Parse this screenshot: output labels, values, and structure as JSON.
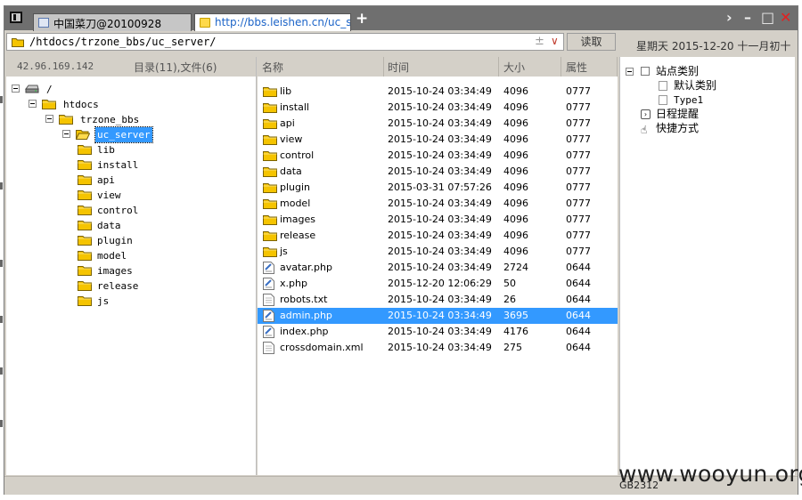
{
  "window": {
    "tabs": [
      {
        "label": "中国菜刀@20100928",
        "active": false
      },
      {
        "label": "http://bbs.leishen.cn/uc_serv...",
        "active": true
      }
    ],
    "new_tab_label": "+",
    "controls": {
      "more": "›",
      "minimize": "–",
      "maximize": "□",
      "close": "✕"
    }
  },
  "toolbar": {
    "path": "/htdocs/trzone_bbs/uc_server/",
    "path_controls": {
      "plusminus": "±",
      "dropdown": "∨"
    },
    "read_button": "读取",
    "datetime": "星期天 2015-12-20 十一月初十"
  },
  "left_pane": {
    "ip": "42.96.169.142",
    "counts": "目录(11),文件(6)",
    "tree": [
      {
        "label": "/",
        "level": 0,
        "icon": "drive-icon",
        "expanded": true
      },
      {
        "label": "htdocs",
        "level": 1,
        "icon": "folder-icon",
        "expanded": true
      },
      {
        "label": "trzone_bbs",
        "level": 2,
        "icon": "folder-icon",
        "expanded": true
      },
      {
        "label": "uc_server",
        "level": 3,
        "icon": "folder-open-icon",
        "expanded": true,
        "selected": true
      },
      {
        "label": "lib",
        "level": 4,
        "icon": "folder-icon"
      },
      {
        "label": "install",
        "level": 4,
        "icon": "folder-icon"
      },
      {
        "label": "api",
        "level": 4,
        "icon": "folder-icon"
      },
      {
        "label": "view",
        "level": 4,
        "icon": "folder-icon"
      },
      {
        "label": "control",
        "level": 4,
        "icon": "folder-icon"
      },
      {
        "label": "data",
        "level": 4,
        "icon": "folder-icon"
      },
      {
        "label": "plugin",
        "level": 4,
        "icon": "folder-icon"
      },
      {
        "label": "model",
        "level": 4,
        "icon": "folder-icon"
      },
      {
        "label": "images",
        "level": 4,
        "icon": "folder-icon"
      },
      {
        "label": "release",
        "level": 4,
        "icon": "folder-icon"
      },
      {
        "label": "js",
        "level": 4,
        "icon": "folder-icon"
      }
    ]
  },
  "file_list": {
    "columns": {
      "name": "名称",
      "time": "时间",
      "size": "大小",
      "attr": "属性"
    },
    "rows": [
      {
        "name": "lib",
        "time": "2015-10-24 03:34:49",
        "size": "4096",
        "attr": "0777",
        "type": "folder"
      },
      {
        "name": "install",
        "time": "2015-10-24 03:34:49",
        "size": "4096",
        "attr": "0777",
        "type": "folder"
      },
      {
        "name": "api",
        "time": "2015-10-24 03:34:49",
        "size": "4096",
        "attr": "0777",
        "type": "folder"
      },
      {
        "name": "view",
        "time": "2015-10-24 03:34:49",
        "size": "4096",
        "attr": "0777",
        "type": "folder"
      },
      {
        "name": "control",
        "time": "2015-10-24 03:34:49",
        "size": "4096",
        "attr": "0777",
        "type": "folder"
      },
      {
        "name": "data",
        "time": "2015-10-24 03:34:49",
        "size": "4096",
        "attr": "0777",
        "type": "folder"
      },
      {
        "name": "plugin",
        "time": "2015-03-31 07:57:26",
        "size": "4096",
        "attr": "0777",
        "type": "folder"
      },
      {
        "name": "model",
        "time": "2015-10-24 03:34:49",
        "size": "4096",
        "attr": "0777",
        "type": "folder"
      },
      {
        "name": "images",
        "time": "2015-10-24 03:34:49",
        "size": "4096",
        "attr": "0777",
        "type": "folder"
      },
      {
        "name": "release",
        "time": "2015-10-24 03:34:49",
        "size": "4096",
        "attr": "0777",
        "type": "folder"
      },
      {
        "name": "js",
        "time": "2015-10-24 03:34:49",
        "size": "4096",
        "attr": "0777",
        "type": "folder"
      },
      {
        "name": "avatar.php",
        "time": "2015-10-24 03:34:49",
        "size": "2724",
        "attr": "0644",
        "type": "php"
      },
      {
        "name": "x.php",
        "time": "2015-12-20 12:06:29",
        "size": "50",
        "attr": "0644",
        "type": "php"
      },
      {
        "name": "robots.txt",
        "time": "2015-10-24 03:34:49",
        "size": "26",
        "attr": "0644",
        "type": "txt"
      },
      {
        "name": "admin.php",
        "time": "2015-10-24 03:34:49",
        "size": "3695",
        "attr": "0644",
        "type": "php",
        "selected": true
      },
      {
        "name": "index.php",
        "time": "2015-10-24 03:34:49",
        "size": "4176",
        "attr": "0644",
        "type": "php"
      },
      {
        "name": "crossdomain.xml",
        "time": "2015-10-24 03:34:49",
        "size": "275",
        "attr": "0644",
        "type": "txt"
      }
    ]
  },
  "right_pane": {
    "site_category": "站点类别",
    "default_category": "默认类别",
    "type1": "Type1",
    "schedule": "日程提醒",
    "shortcuts": "快捷方式"
  },
  "status": {
    "encoding": "GB2312"
  },
  "watermark": "www.wooyun.org",
  "colors": {
    "selection": "#3399ff",
    "folder": "#f5c400",
    "chrome": "#d4d0c8",
    "titlebar": "#6f6f6f"
  }
}
